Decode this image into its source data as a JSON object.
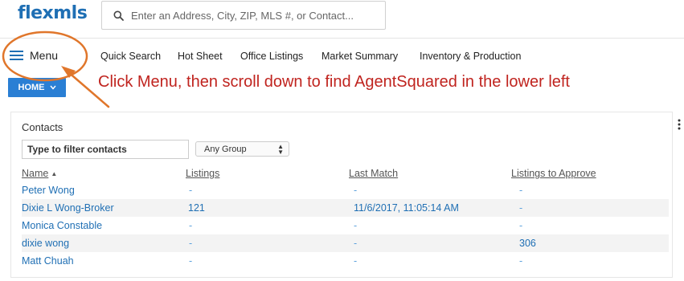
{
  "header": {
    "logo": "flexmls",
    "search_placeholder": "Enter an Address, City, ZIP, MLS #, or Contact..."
  },
  "nav": {
    "menu_label": "Menu",
    "items": [
      "Quick Search",
      "Hot Sheet",
      "Office Listings",
      "Market Summary",
      "Inventory & Production"
    ]
  },
  "home_button": {
    "label": "HOME",
    "icon": "chevron-down-icon"
  },
  "annotation": {
    "text": "Click Menu, then scroll down to find AgentSquared in the lower left",
    "color": "#c0241f"
  },
  "contacts": {
    "title": "Contacts",
    "filter_placeholder": "Type to filter contacts",
    "group_selected": "Any Group",
    "columns": [
      "Name",
      "Listings",
      "Last Match",
      "Listings to Approve"
    ],
    "sort_indicator": "▲",
    "rows": [
      {
        "name": "Peter Wong",
        "listings": "-",
        "last_match": "-",
        "to_approve": "-"
      },
      {
        "name": "Dixie L Wong-Broker",
        "listings": "121",
        "last_match": "11/6/2017, 11:05:14 AM",
        "to_approve": "-"
      },
      {
        "name": "Monica Constable",
        "listings": "-",
        "last_match": "-",
        "to_approve": "-"
      },
      {
        "name": "dixie wong",
        "listings": "-",
        "last_match": "-",
        "to_approve": "306"
      },
      {
        "name": "Matt Chuah",
        "listings": "-",
        "last_match": "-",
        "to_approve": "-"
      }
    ]
  },
  "colors": {
    "brand_blue": "#1f6fb4",
    "home_button": "#2a7fd4",
    "annotation_red": "#c0241f",
    "circle_orange": "#e0762b"
  }
}
